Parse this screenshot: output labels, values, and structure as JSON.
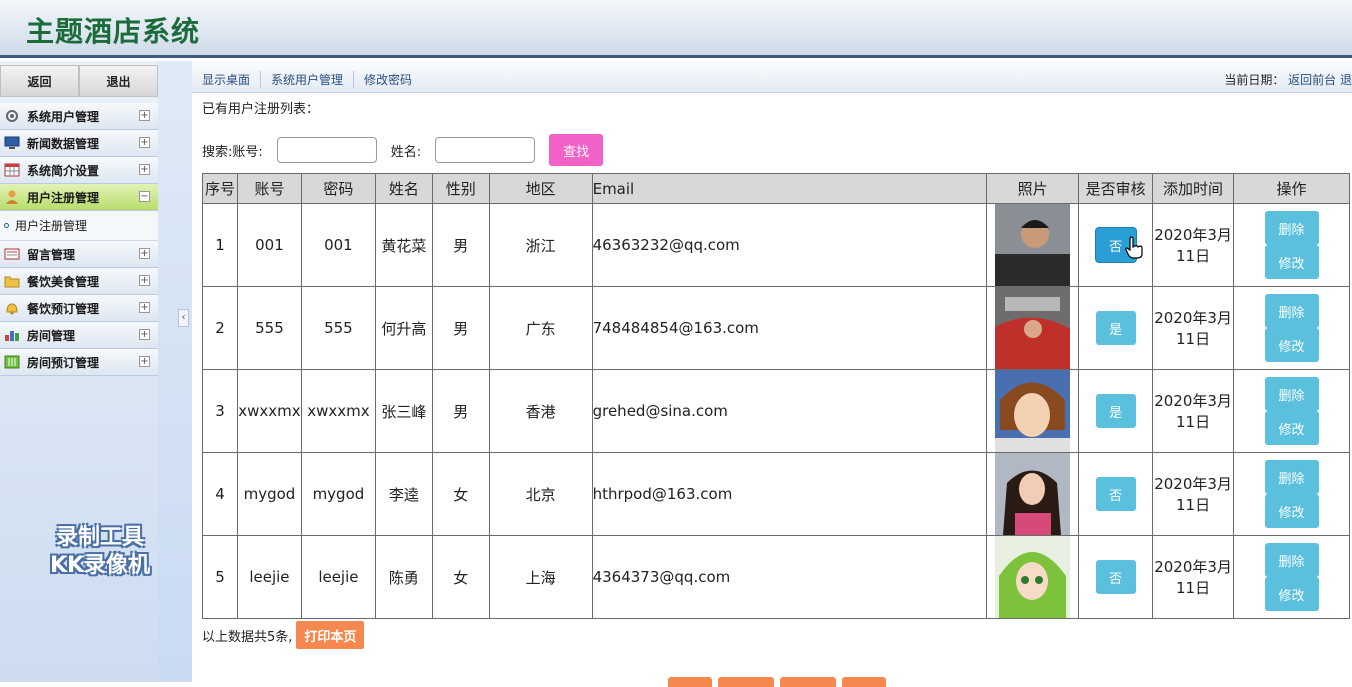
{
  "header": {
    "title": "主题酒店系统"
  },
  "sidebar": {
    "back_label": "返回",
    "logout_label": "退出",
    "items": [
      {
        "label": "系统用户管理",
        "icon": "gear-icon"
      },
      {
        "label": "新闻数据管理",
        "icon": "monitor-icon"
      },
      {
        "label": "系统简介设置",
        "icon": "calendar-icon"
      },
      {
        "label": "用户注册管理",
        "icon": "user-icon"
      },
      {
        "label": "留言管理",
        "icon": "message-icon"
      },
      {
        "label": "餐饮美食管理",
        "icon": "folder-icon"
      },
      {
        "label": "餐饮预订管理",
        "icon": "bell-icon"
      },
      {
        "label": "房间管理",
        "icon": "chart-icon"
      },
      {
        "label": "房间预订管理",
        "icon": "chart-icon"
      }
    ],
    "sub_item": "用户注册管理",
    "watermark_line1": "录制工具",
    "watermark_line2": "KK录像机"
  },
  "nav": {
    "links": [
      "显示桌面",
      "系统用户管理",
      "修改密码"
    ],
    "date_label": "当前日期：",
    "return_link": "返回前台 退"
  },
  "main": {
    "list_title": "已有用户注册列表：",
    "search_account_label": "搜索:账号:",
    "search_name_label": "姓名:",
    "find_label": "查找",
    "columns": [
      "序号",
      "账号",
      "密码",
      "姓名",
      "性别",
      "地区",
      "Email",
      "照片",
      "是否审核",
      "添加时间",
      "操作"
    ],
    "rows": [
      {
        "no": "1",
        "account": "001",
        "password": "001",
        "name": "黄花菜",
        "gender": "男",
        "region": "浙江",
        "email": "46363232@qq.com",
        "audit": "否",
        "time": "2020年3月11日"
      },
      {
        "no": "2",
        "account": "555",
        "password": "555",
        "name": "何升高",
        "gender": "男",
        "region": "广东",
        "email": "748484854@163.com",
        "audit": "是",
        "time": "2020年3月11日"
      },
      {
        "no": "3",
        "account": "xwxxmx",
        "password": "xwxxmx",
        "name": "张三峰",
        "gender": "男",
        "region": "香港",
        "email": "grehed@sina.com",
        "audit": "是",
        "time": "2020年3月11日"
      },
      {
        "no": "4",
        "account": "mygod",
        "password": "mygod",
        "name": "李逵",
        "gender": "女",
        "region": "北京",
        "email": "hthrpod@163.com",
        "audit": "否",
        "time": "2020年3月11日"
      },
      {
        "no": "5",
        "account": "leejie",
        "password": "leejie",
        "name": "陈勇",
        "gender": "女",
        "region": "上海",
        "email": "4364373@qq.com",
        "audit": "否",
        "time": "2020年3月11日"
      }
    ],
    "delete_label": "删除",
    "edit_label": "修改",
    "summary": "以上数据共5条,",
    "print_label": "打印本页"
  }
}
